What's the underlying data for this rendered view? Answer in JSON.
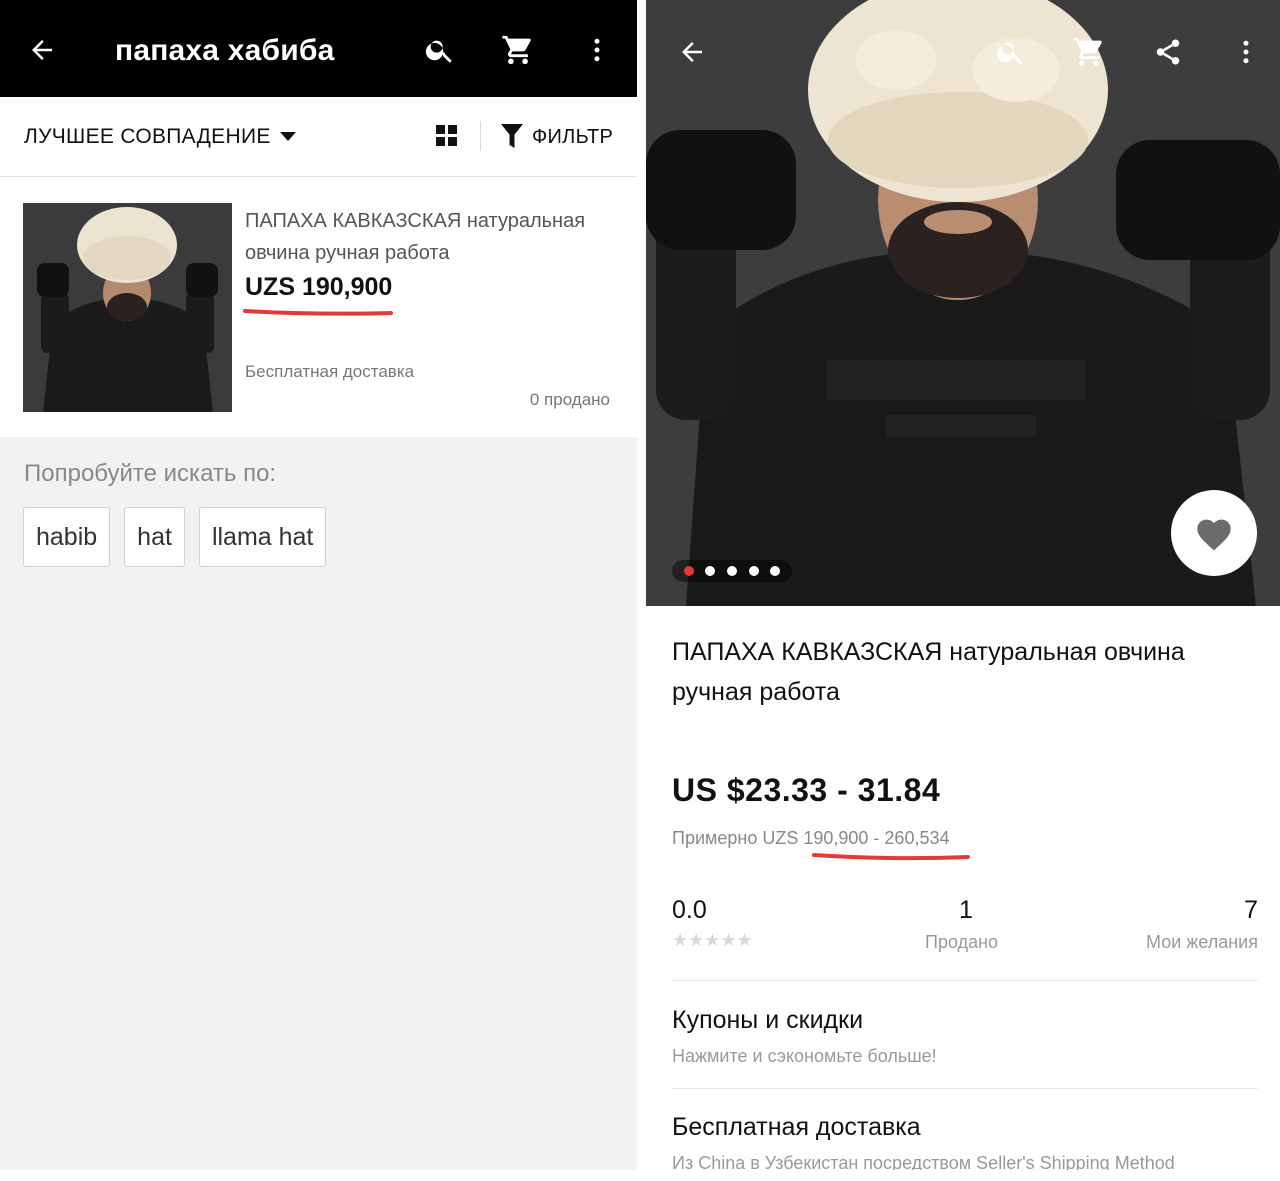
{
  "search_screen": {
    "appbar": {
      "back_icon": "arrow-left-icon",
      "title": "папаха хабиба",
      "icons": [
        "search-icon",
        "cart-icon",
        "more-vert-icon"
      ]
    },
    "sort": {
      "label": "ЛУЧШЕЕ СОВПАДЕНИЕ",
      "filter_label": "ФИЛЬТР"
    },
    "result": {
      "title": "ПАПАХА КАВКАЗСКАЯ натуральная овчина ручная работа",
      "price": "UZS 190,900",
      "shipping": "Бесплатная доставка",
      "sold": "0 продано"
    },
    "suggest": {
      "label": "Попробуйте искать по:",
      "chips": [
        "habib",
        "hat",
        "llama hat"
      ]
    }
  },
  "product_screen": {
    "toolbar_icons": [
      "arrow-left-icon",
      "search-icon",
      "cart-icon",
      "share-icon",
      "more-vert-icon"
    ],
    "gallery": {
      "total": 5,
      "active": 1
    },
    "title": "ПАПАХА КАВКАЗСКАЯ натуральная овчина ручная работа",
    "price": "US $23.33 - 31.84",
    "approx_prefix": "Примерно UZS ",
    "approx_range": "190,900 - 260,534",
    "rating": {
      "value": "0.0",
      "stars": "★★★★★",
      "stars_filled": 0
    },
    "sold": {
      "value": "1",
      "label": "Продано"
    },
    "wishlist": {
      "value": "7",
      "label": "Мои желания"
    },
    "coupons": {
      "title": "Купоны и скидки",
      "subtitle": "Нажмите и сэкономьте больше!"
    },
    "delivery": {
      "title": "Бесплатная доставка",
      "subtitle": "Из China в Узбекистан посредством Seller's Shipping Method"
    }
  },
  "colors": {
    "appbar": "#000000",
    "accent_red": "#e53935",
    "panel_bg": "#f2f2f2"
  }
}
